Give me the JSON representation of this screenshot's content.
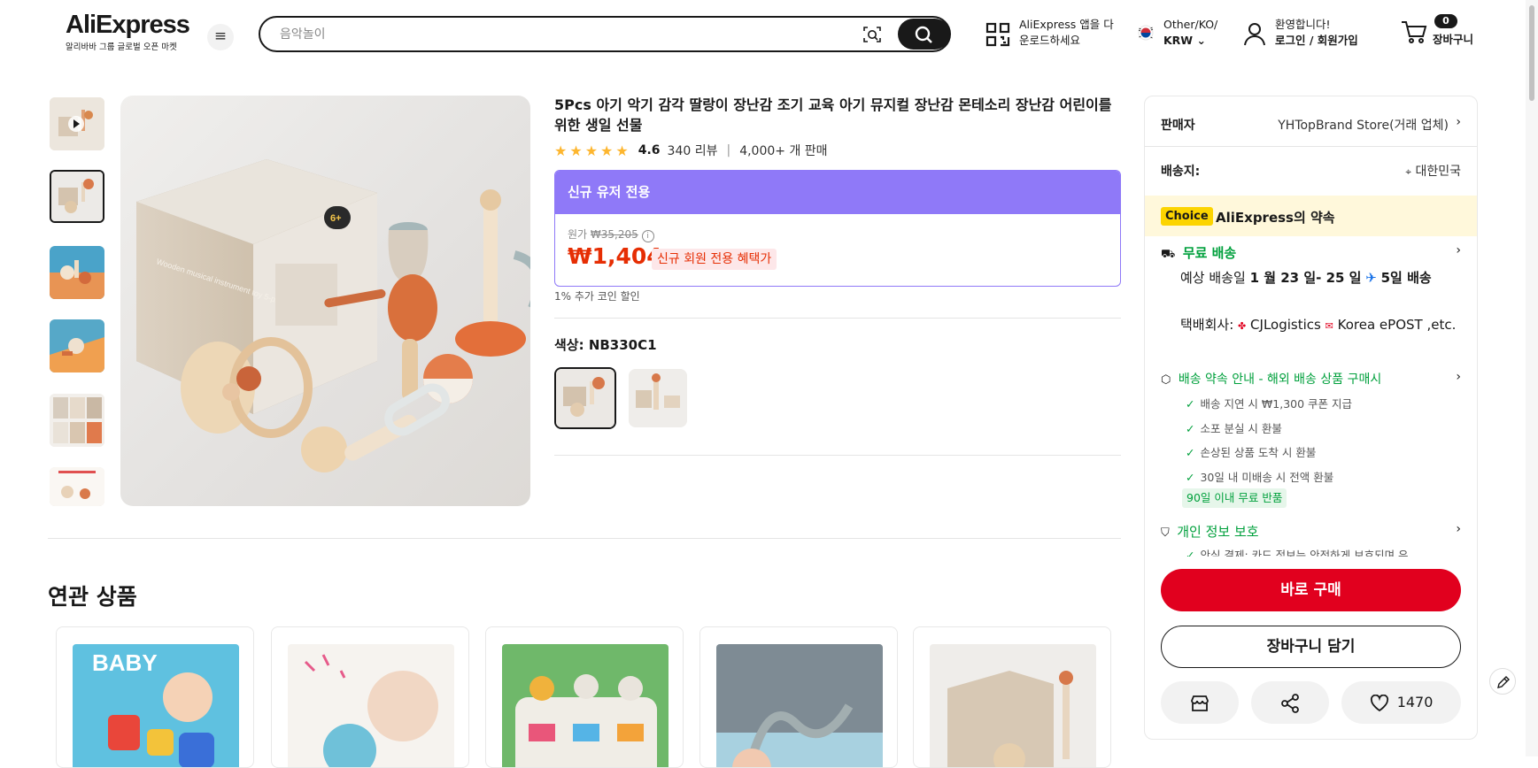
{
  "header": {
    "logo": "AliExpress",
    "logo_sub": "알리바바 그룹 글로벌 오픈 마켓",
    "search_placeholder": "음악놀이",
    "app_line1": "AliExpress 앱을 다",
    "app_line2": "운로드하세요",
    "locale_line1": "Other/KO/",
    "locale_line2": "KRW",
    "account_line1": "환영합니다!",
    "account_line2": "로그인 / 회원가입",
    "cart_count": "0",
    "cart_label": "장바구니"
  },
  "product": {
    "title": "5Pcs 아기 악기 감각 딸랑이 장난감 조기 교육 아기 뮤지컬 장난감 몬테소리 장난감 어린이를 위한 생일 선물",
    "rating": "4.6",
    "reviews": "340 리뷰",
    "sold": "4,000+ 개 판매",
    "star_fill": 0.92,
    "promo_header": "신규 유저 전용",
    "orig_label": "원가",
    "orig_price": "₩35,205",
    "price": "₩1,404",
    "price_badge": "신규 회원 전용 혜택가",
    "coin_discount": "1% 추가 코인 할인",
    "color_label": "색상: NB330C1",
    "box_text": "Wooden musical instrument toy 5-piece set",
    "box_badge": "6+"
  },
  "panel": {
    "seller_label": "판매자",
    "seller_name": "YHTopBrand Store(거래 업체)",
    "ship_to_label": "배송지:",
    "ship_to": "대한민국",
    "choice_badge": "Choice",
    "choice_text": "AliExpress의 약속",
    "free_shipping": "무료 배송",
    "delivery_prefix": "예상 배송일",
    "delivery_dates": "1 월 23 일- 25 일",
    "delivery_days": "5일 배송",
    "carrier_prefix": "택배회사:",
    "carrier1": "CJLogistics",
    "carrier2": "Korea ePOST ,etc.",
    "guarantee_title": "배송 약속 안내 - 해외 배송 상품 구매시",
    "guarantees": [
      "배송 지연 시 ₩1,300 쿠폰 지급",
      "소포 분실 시 환불",
      "손상된 상품 도착 시 환불",
      "30일 내 미배송 시 전액 환불"
    ],
    "free_return": "90일 이내 무료 반품",
    "privacy_title": "개인 정보 보호",
    "privacy_sub": "안심 결제: 카드 정보는 안전하게 보호되며 유",
    "buy_now": "바로 구매",
    "add_to_cart": "장바구니 담기",
    "wishlist_count": "1470"
  },
  "related": {
    "title": "연관 상품",
    "card1_text": "BABY"
  }
}
